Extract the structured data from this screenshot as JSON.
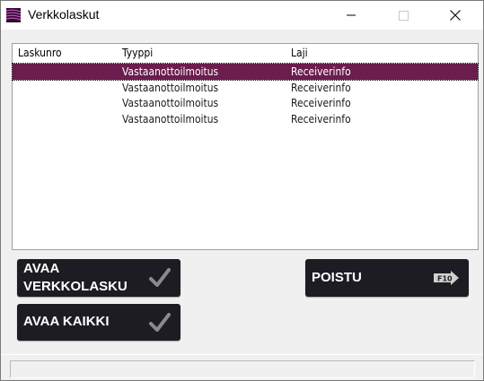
{
  "window": {
    "title": "Verkkolaskut",
    "icon": "app-icon"
  },
  "list": {
    "columns": [
      "Laskunro",
      "Tyyppi",
      "Laji"
    ],
    "rows": [
      {
        "laskunro": "",
        "tyyppi": "Vastaanottoilmoitus",
        "laji": "Receiverinfo",
        "selected": true
      },
      {
        "laskunro": "",
        "tyyppi": "Vastaanottoilmoitus",
        "laji": "Receiverinfo",
        "selected": false
      },
      {
        "laskunro": "",
        "tyyppi": "Vastaanottoilmoitus",
        "laji": "Receiverinfo",
        "selected": false
      },
      {
        "laskunro": "",
        "tyyppi": "Vastaanottoilmoitus",
        "laji": "Receiverinfo",
        "selected": false
      }
    ],
    "selected_color": "#6b1d4d"
  },
  "buttons": {
    "open_invoice": {
      "line1": "AVAA",
      "line2": "VERKKOLASKU",
      "icon": "check-icon"
    },
    "open_all": {
      "label": "AVAA KAIKKI",
      "icon": "check-icon"
    },
    "exit": {
      "label": "POISTU",
      "key_icon": "f10-key-icon",
      "key": "F10"
    }
  },
  "status": {
    "text": ""
  }
}
